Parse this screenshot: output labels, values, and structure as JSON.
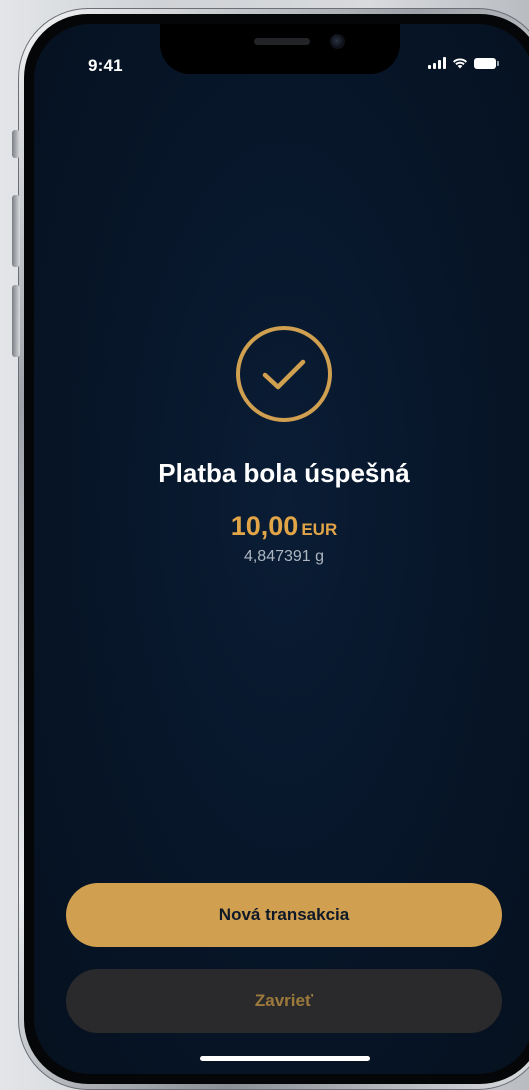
{
  "status_bar": {
    "time": "9:41",
    "icons": [
      "signal-icon",
      "wifi-icon",
      "battery-icon"
    ]
  },
  "success": {
    "icon": "check-circle-icon",
    "title": "Platba bola úspešná",
    "amount": "10,00",
    "currency": "EUR",
    "grams": "4,847391 g"
  },
  "actions": {
    "new_transaction_label": "Nová transakcia",
    "close_label": "Zavrieť"
  },
  "colors": {
    "background": "#071528",
    "accent_gold": "#d0a050",
    "amount_gold": "#e1a547",
    "secondary_button": "#2a2a2c",
    "text_primary": "#ffffff",
    "text_muted": "#aeb6c2"
  }
}
